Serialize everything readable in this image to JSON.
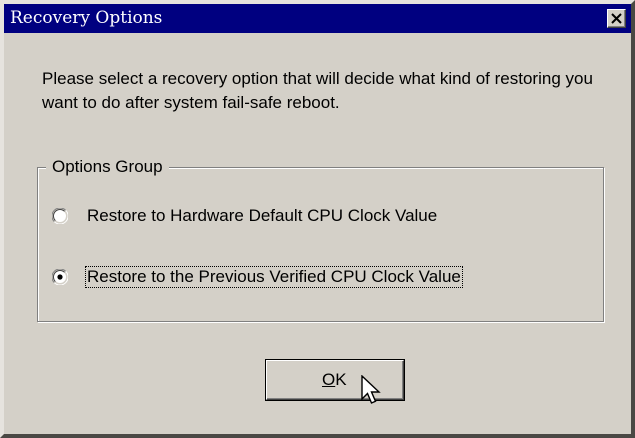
{
  "window": {
    "title": "Recovery Options",
    "close_icon": "close-icon",
    "title_bar_color": "#000080",
    "background_color": "#d4d0c8"
  },
  "message": "Please select a recovery option that will decide what kind of restoring you want to do after system fail-safe reboot.",
  "options_group": {
    "label": "Options Group",
    "options": [
      {
        "label": "Restore to Hardware Default CPU Clock Value",
        "selected": false
      },
      {
        "label": "Restore to the Previous Verified CPU Clock Value",
        "selected": true
      }
    ]
  },
  "ok_button": {
    "mnemonic": "O",
    "rest": "K"
  },
  "cursor_icon": "arrow-cursor-icon"
}
